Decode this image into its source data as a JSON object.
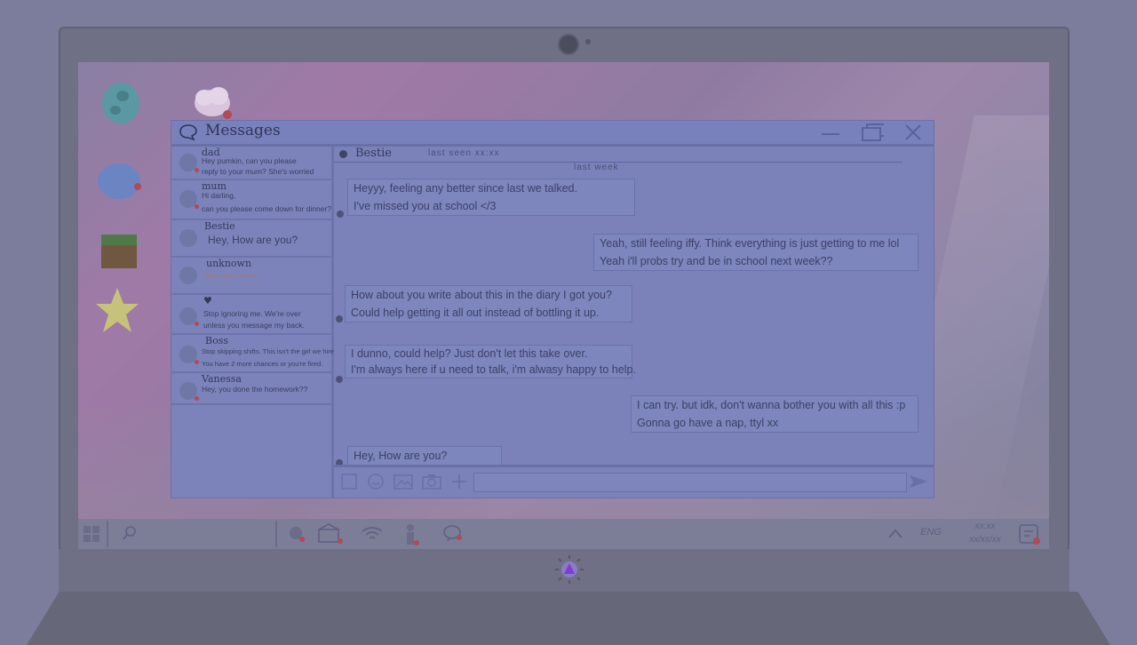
{
  "window": {
    "title": "Messages"
  },
  "contacts": [
    {
      "name": "dad",
      "preview_lines": [
        "Hey pumkin, can you please",
        "reply to your mum? She's worried"
      ],
      "unread": true
    },
    {
      "name": "mum",
      "preview_lines": [
        "Hi darling,",
        "can you please come down for dinner?"
      ],
      "unread": true
    },
    {
      "name": "Bestie",
      "preview_lines": [
        "Hey, How are you?"
      ],
      "unread": false
    },
    {
      "name": "unknown",
      "preview_lines": [
        "this one is mine"
      ],
      "unread": true
    },
    {
      "name": "♥",
      "preview_lines": [
        "Stop ignoring me. We're over",
        "unless you message my back."
      ],
      "unread": true
    },
    {
      "name": "Boss",
      "preview_lines": [
        "Stop skipping shifts. This isn't the girl we hired.",
        "You have 2 more chances or you're fired."
      ],
      "unread": true
    },
    {
      "name": "Vanessa",
      "preview_lines": [
        "Hey, you done the homework??"
      ],
      "unread": true
    }
  ],
  "chat": {
    "contact_name": "Bestie",
    "last_seen": "last seen xx:xx",
    "divider_label": "last week",
    "messages": [
      {
        "from": "them",
        "lines": [
          "Heyyy, feeling any better since last we talked.",
          "I've missed you at school </3"
        ]
      },
      {
        "from": "me",
        "lines": [
          "Yeah, still feeling iffy. Think everything is just getting to me lol",
          "Yeah i'll probs try and be in school next week??"
        ]
      },
      {
        "from": "them",
        "lines": [
          "How about you write about this in the diary I got you?",
          "Could help getting it all out instead of bottling it up."
        ]
      },
      {
        "from": "them",
        "lines": [
          "I dunno, could help? Just don't let this take over.",
          "I'm always here if u need to talk, i'm alwasy happy to help."
        ]
      },
      {
        "from": "me",
        "lines": [
          "I can try. but idk, don't wanna bother you with all this :p",
          "Gonna go have a nap, ttyl xx"
        ]
      },
      {
        "from": "them",
        "lines": [
          "Hey, How are you?"
        ]
      }
    ],
    "compose_value": ""
  },
  "taskbar": {
    "language": "ENG",
    "time": "xx:xx",
    "date": "xx/xx/xx",
    "icons": [
      "start-icon",
      "search-icon",
      "record-icon",
      "mail-icon",
      "wifi-icon",
      "user-icon",
      "messages-icon",
      "chevron-up-icon",
      "notification-icon"
    ]
  },
  "colors": {
    "window_bg": "#7a82b9",
    "titlebar": "#7881bb",
    "accent_unread": "#b04a57",
    "unknown_preview": "#b8735a",
    "power_glow": "#7b3fd6"
  }
}
